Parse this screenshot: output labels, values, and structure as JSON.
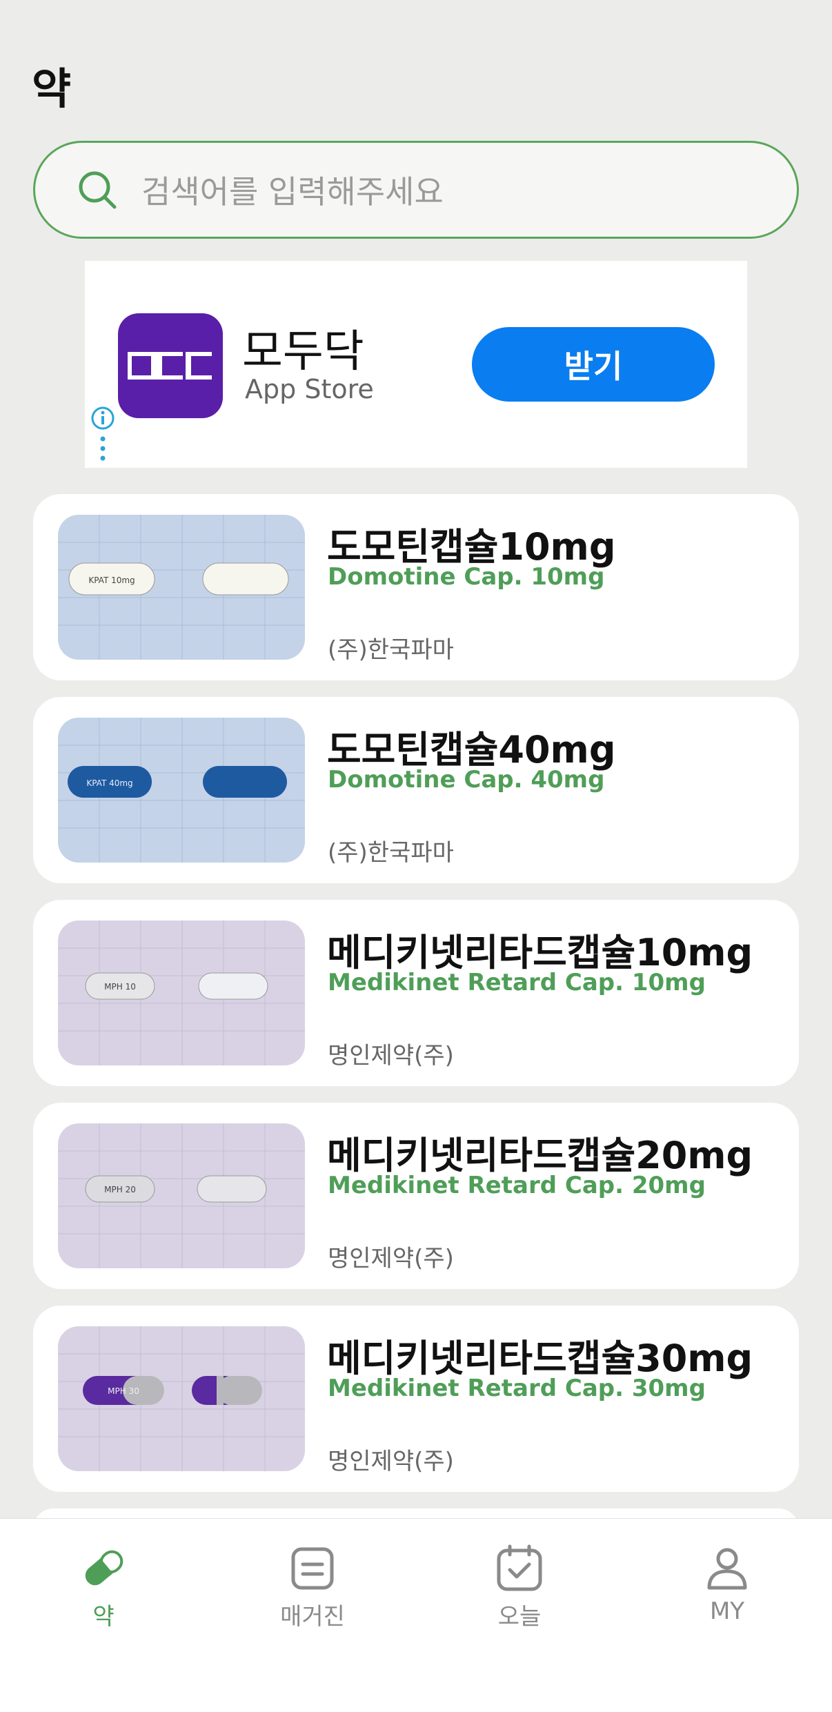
{
  "header": {
    "title": "약"
  },
  "search": {
    "placeholder": "검색어를 입력해주세요"
  },
  "ad": {
    "app_name": "모두닥",
    "store": "App Store",
    "button_label": "받기",
    "icon_text": "OCC",
    "icon_color": "#5a1fa8",
    "button_color": "#0a7df0"
  },
  "drugs": [
    {
      "name_ko": "도모틴캡슐10mg",
      "name_en": "Domotine Cap. 10mg",
      "maker": "(주)한국파마",
      "imprint": "KPAT 10mg"
    },
    {
      "name_ko": "도모틴캡슐40mg",
      "name_en": "Domotine Cap. 40mg",
      "maker": "(주)한국파마",
      "imprint": "KPAT 40mg"
    },
    {
      "name_ko": "메디키넷리타드캡슐10mg",
      "name_en": "Medikinet Retard Cap. 10mg",
      "maker": "명인제약(주)",
      "imprint": "MPH 10"
    },
    {
      "name_ko": "메디키넷리타드캡슐20mg",
      "name_en": "Medikinet Retard Cap. 20mg",
      "maker": "명인제약(주)",
      "imprint": "MPH 20"
    },
    {
      "name_ko": "메디키넷리타드캡슐30mg",
      "name_en": "Medikinet Retard Cap. 30mg",
      "maker": "명인제약(주)",
      "imprint": "MPH 30"
    }
  ],
  "tabs": [
    {
      "label": "약",
      "icon": "pill-icon",
      "active": true
    },
    {
      "label": "매거진",
      "icon": "magazine-icon",
      "active": false
    },
    {
      "label": "오늘",
      "icon": "calendar-check-icon",
      "active": false
    },
    {
      "label": "MY",
      "icon": "person-icon",
      "active": false
    }
  ],
  "colors": {
    "accent": "#4f9e58",
    "background": "#ececea"
  }
}
